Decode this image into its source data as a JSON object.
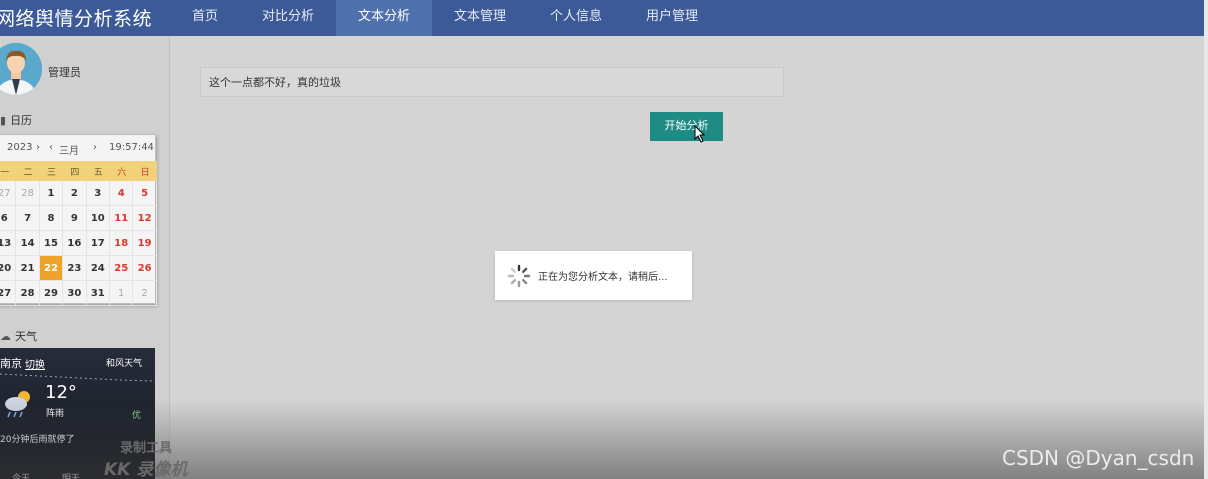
{
  "app": {
    "title": "网络舆情分析系统"
  },
  "nav": {
    "items": [
      {
        "label": "首页"
      },
      {
        "label": "对比分析"
      },
      {
        "label": "文本分析"
      },
      {
        "label": "文本管理"
      },
      {
        "label": "个人信息"
      },
      {
        "label": "用户管理"
      }
    ],
    "active_index": 2
  },
  "user": {
    "role": "管理员"
  },
  "calendar": {
    "section_title": "日历",
    "year": "2023",
    "month": "三月",
    "time": "19:57:44",
    "weekdays": [
      "一",
      "二",
      "三",
      "四",
      "五",
      "六",
      "日"
    ],
    "weeks": [
      [
        "27",
        "28",
        "1",
        "2",
        "3",
        "4",
        "5"
      ],
      [
        "6",
        "7",
        "8",
        "9",
        "10",
        "11",
        "12"
      ],
      [
        "13",
        "14",
        "15",
        "16",
        "17",
        "18",
        "19"
      ],
      [
        "20",
        "21",
        "22",
        "23",
        "24",
        "25",
        "26"
      ],
      [
        "27",
        "28",
        "29",
        "30",
        "31",
        "1",
        "2"
      ]
    ],
    "selected_day": "22"
  },
  "weather": {
    "section_title": "天气",
    "city": "南京",
    "switch_label": "切换",
    "provider": "和风天气",
    "temperature": "12°",
    "condition": "阵雨",
    "aqi": "优",
    "tip": "20分钟后雨就停了",
    "days": [
      "今天",
      "明天"
    ]
  },
  "main": {
    "input_value": "这个一点都不好，真的垃圾",
    "analyze_button": "开始分析",
    "loading_text": "正在为您分析文本，请稍后..."
  },
  "watermarks": {
    "tool": "录制工具",
    "recorder": "KK 录像机",
    "csdn": "CSDN @Dyan_csdn"
  },
  "colors": {
    "nav_bg": "#3c5a97",
    "nav_active": "#4f72ad",
    "button": "#1e8c84",
    "calendar_header": "#f1d27a",
    "calendar_today": "#f0a22b",
    "weekend": "#d9392b"
  }
}
